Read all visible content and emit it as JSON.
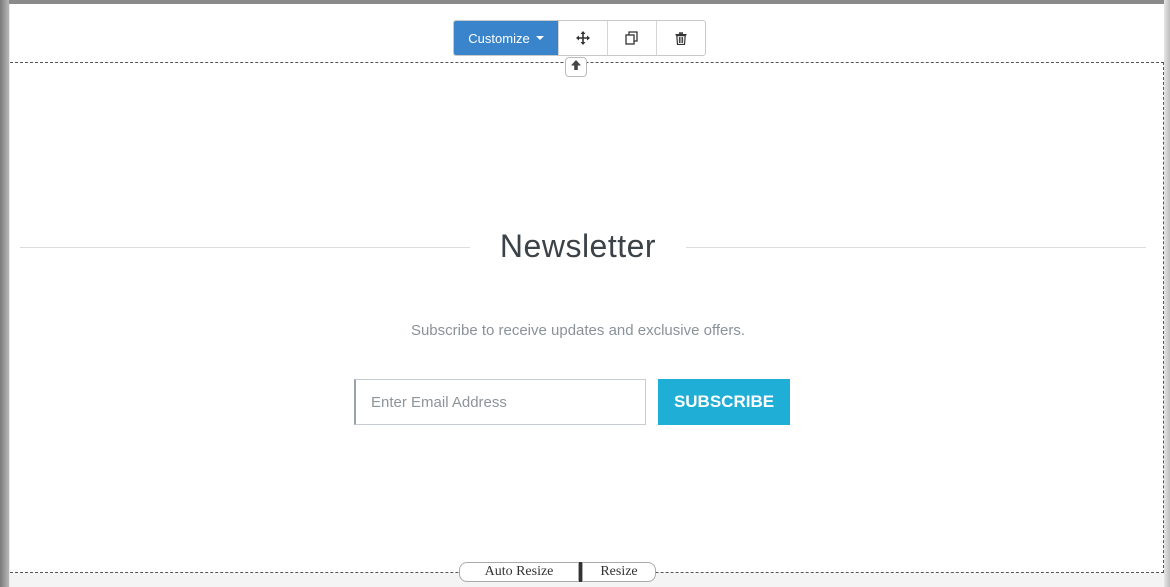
{
  "toolbar": {
    "customize_label": "Customize",
    "move_icon": "move-icon",
    "duplicate_icon": "duplicate-icon",
    "delete_icon": "trash-icon",
    "accent_color": "#3a84cc"
  },
  "newsletter": {
    "title": "Newsletter",
    "subtitle": "Subscribe to receive updates and exclusive offers.",
    "email_placeholder": "Enter Email Address",
    "email_value": "",
    "subscribe_label": "SUBSCRIBE",
    "button_color": "#1eaed6"
  },
  "resize": {
    "auto_label": "Auto Resize",
    "resize_label": "Resize"
  }
}
